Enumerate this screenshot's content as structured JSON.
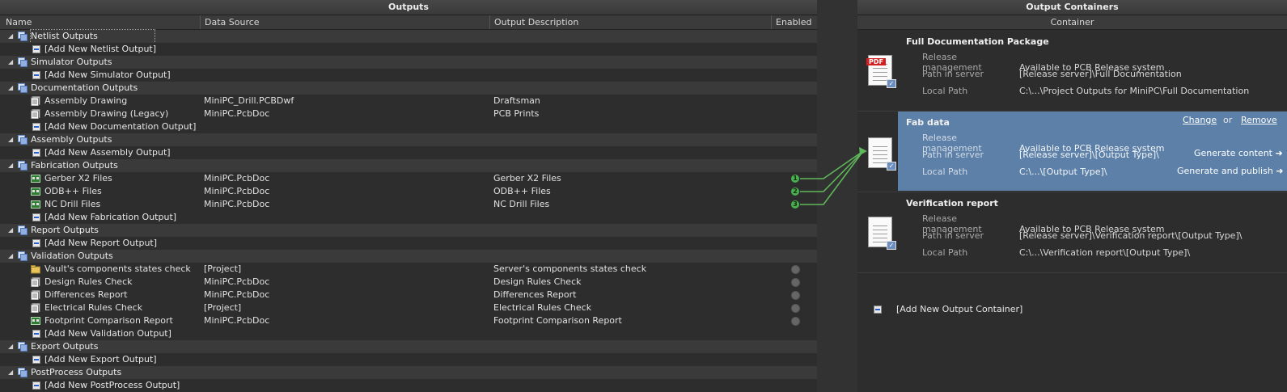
{
  "outputs": {
    "title": "Outputs",
    "columns": [
      "Name",
      "Data Source",
      "Output Description",
      "Enabled"
    ],
    "groups": [
      {
        "name": "Netlist Outputs",
        "items": [],
        "add": "[Add New Netlist Output]"
      },
      {
        "name": "Simulator Outputs",
        "items": [],
        "add": "[Add New Simulator Output]"
      },
      {
        "name": "Documentation Outputs",
        "items": [
          {
            "name": "Assembly Drawing",
            "source": "MiniPC_Drill.PCBDwf",
            "desc": "Draftsman",
            "enabled": ""
          },
          {
            "name": "Assembly Drawing (Legacy)",
            "source": "MiniPC.PcbDoc",
            "desc": "PCB Prints",
            "enabled": ""
          }
        ],
        "add": "[Add New Documentation Output]"
      },
      {
        "name": "Assembly Outputs",
        "items": [],
        "add": "[Add New Assembly Output]"
      },
      {
        "name": "Fabrication Outputs",
        "items": [
          {
            "name": "Gerber X2 Files",
            "source": "MiniPC.PcbDoc",
            "desc": "Gerber X2 Files",
            "enabled": "1"
          },
          {
            "name": "ODB++ Files",
            "source": "MiniPC.PcbDoc",
            "desc": "ODB++ Files",
            "enabled": "2"
          },
          {
            "name": "NC Drill Files",
            "source": "MiniPC.PcbDoc",
            "desc": "NC Drill Files",
            "enabled": "3"
          }
        ],
        "add": "[Add New Fabrication Output]"
      },
      {
        "name": "Report Outputs",
        "items": [],
        "add": "[Add New Report Output]"
      },
      {
        "name": "Validation Outputs",
        "items": [
          {
            "name": "Vault's components states check",
            "source": "[Project]",
            "desc": "Server's components states check",
            "enabled": "off"
          },
          {
            "name": "Design Rules Check",
            "source": "MiniPC.PcbDoc",
            "desc": "Design Rules Check",
            "enabled": "off"
          },
          {
            "name": "Differences Report",
            "source": "MiniPC.PcbDoc",
            "desc": "Differences Report",
            "enabled": "off"
          },
          {
            "name": "Electrical Rules Check",
            "source": "[Project]",
            "desc": "Electrical Rules Check",
            "enabled": "off"
          },
          {
            "name": "Footprint Comparison Report",
            "source": "MiniPC.PcbDoc",
            "desc": "Footprint Comparison Report",
            "enabled": "off"
          }
        ],
        "add": "[Add New Validation Output]"
      },
      {
        "name": "Export Outputs",
        "items": [],
        "add": "[Add New Export Output]"
      },
      {
        "name": "PostProcess Outputs",
        "items": [],
        "add": "[Add New PostProcess Output]"
      }
    ]
  },
  "containers": {
    "title": "Output Containers",
    "column": "Container",
    "items": [
      {
        "title": "Full Documentation Package",
        "icon": "pdf-document-icon",
        "rows": [
          {
            "k": "Release management",
            "v": "Available to PCB Release system"
          },
          {
            "k": "Path in server",
            "v": "[Release server]\\Full Documentation"
          },
          {
            "k": "Local Path",
            "v": "C:\\...\\Project Outputs for MiniPC\\Full Documentation"
          }
        ]
      },
      {
        "title": "Fab data",
        "icon": "document-icon",
        "selected": true,
        "rows": [
          {
            "k": "Release management",
            "v": "Available to PCB Release system"
          },
          {
            "k": "Path in server",
            "v": "[Release server]\\[Output Type]\\"
          },
          {
            "k": "Local Path",
            "v": "C:\\...\\[Output Type]\\"
          }
        ]
      },
      {
        "title": "Verification report",
        "icon": "document-icon",
        "rows": [
          {
            "k": "Release management",
            "v": "Available to PCB Release system"
          },
          {
            "k": "Path in server",
            "v": "[Release server]\\Verification report\\[Output Type]\\"
          },
          {
            "k": "Local Path",
            "v": "C:\\...\\Verification report\\[Output Type]\\"
          }
        ]
      }
    ],
    "change_label": "Change",
    "or_label": "or",
    "remove_label": "Remove",
    "generate_content": "Generate content ➜",
    "generate_publish": "Generate and publish ➜",
    "add_label": "[Add New Output Container]"
  },
  "colors": {
    "selected": "#5d80a8",
    "connector": "#5fb85a",
    "enabled_green": "#4caf50"
  }
}
